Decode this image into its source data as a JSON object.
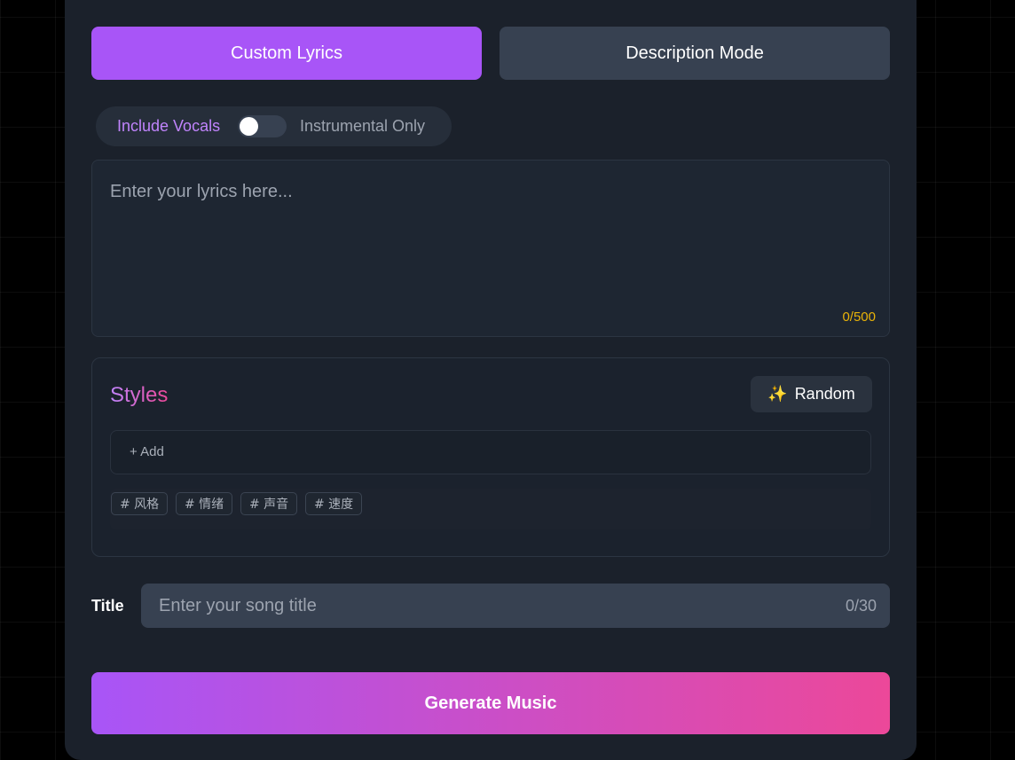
{
  "tabs": {
    "custom_label": "Custom Lyrics",
    "description_label": "Description Mode",
    "active": "Custom Lyrics"
  },
  "vocal_toggle": {
    "left_label": "Include Vocals",
    "right_label": "Instrumental Only",
    "state": "Include Vocals"
  },
  "lyrics": {
    "placeholder": "Enter your lyrics here...",
    "value": "",
    "counter": "0/500"
  },
  "styles": {
    "title": "Styles",
    "random_label": "Random",
    "random_icon": "sparkles-icon",
    "add_label": "+ Add",
    "tags": [
      "# 风格",
      "# 情绪",
      "# 声音",
      "# 速度"
    ]
  },
  "song_title": {
    "label": "Title",
    "placeholder": "Enter your song title",
    "value": "",
    "counter": "0/30"
  },
  "generate": {
    "label": "Generate Music"
  },
  "colors": {
    "accent_purple": "#a855f7",
    "accent_pink": "#ec4899",
    "panel": "#1b212b",
    "counter_yellow": "#eab308"
  }
}
